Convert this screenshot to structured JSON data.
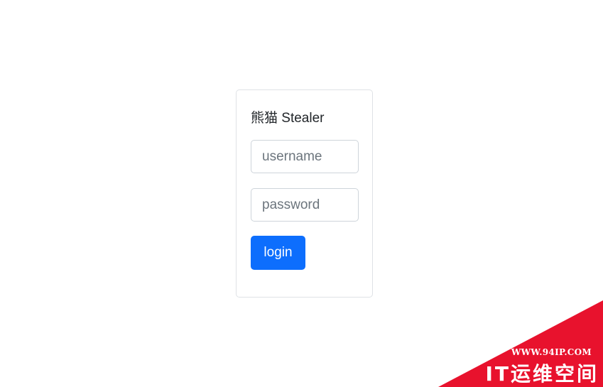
{
  "login_card": {
    "title": "熊猫 Stealer",
    "username": {
      "value": "",
      "placeholder": "username"
    },
    "password": {
      "value": "",
      "placeholder": "password"
    },
    "login_label": "login"
  },
  "watermark": {
    "url": "WWW.94IP.COM",
    "brand": "IT运维空间",
    "color": "#e8122d"
  },
  "colors": {
    "primary_button": "#0d6efd",
    "card_border": "#dfe2e6"
  }
}
